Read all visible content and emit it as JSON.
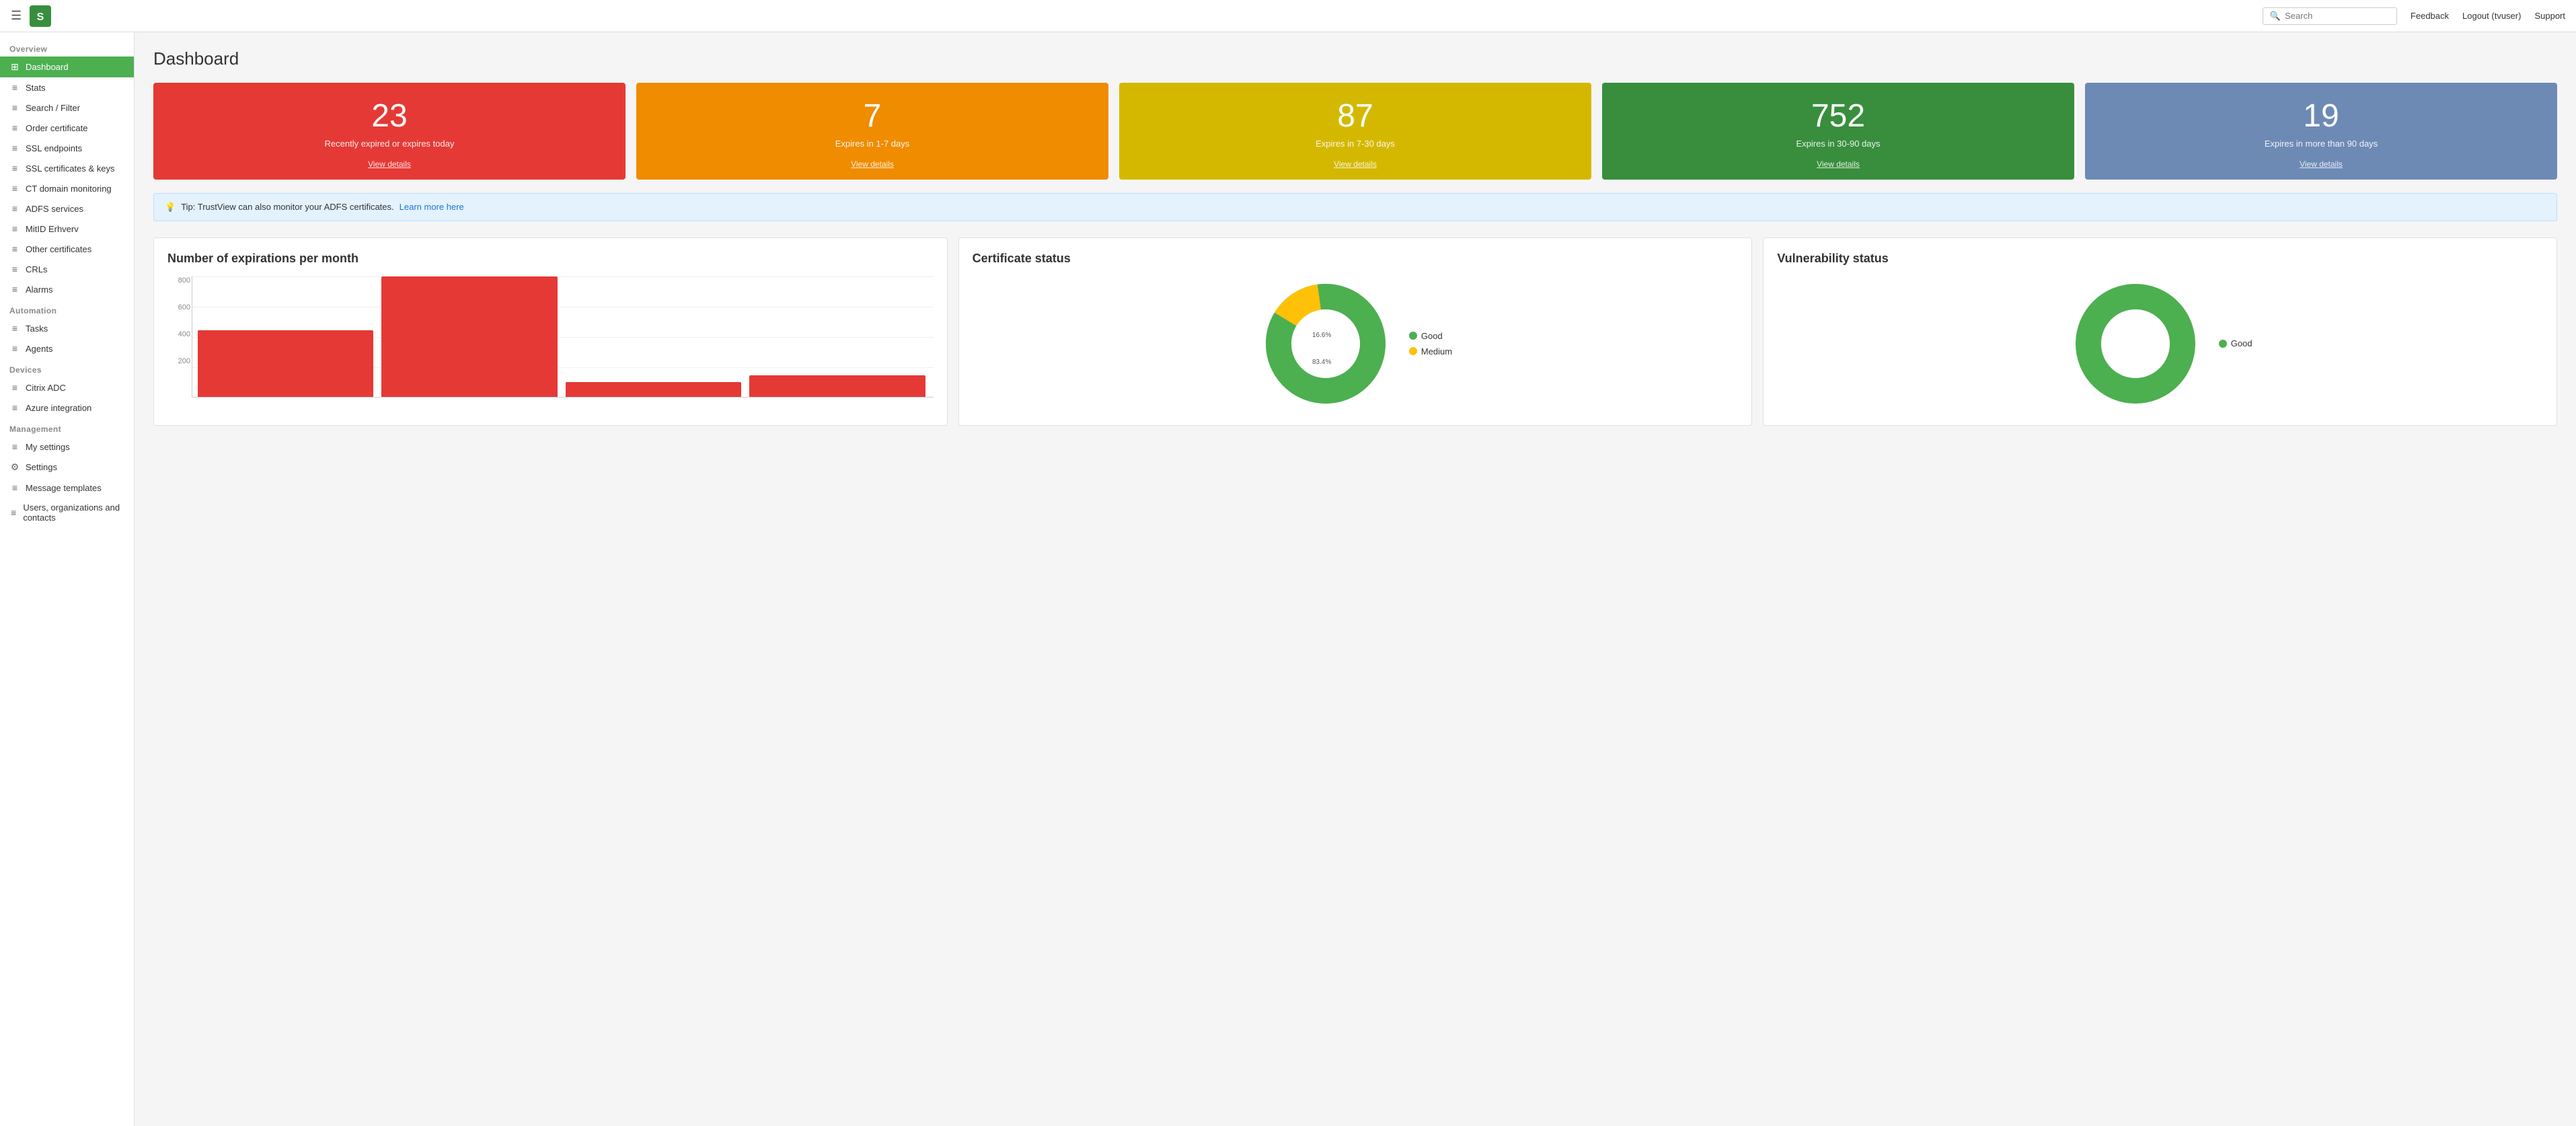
{
  "topbar": {
    "search_placeholder": "Search",
    "feedback_label": "Feedback",
    "logout_label": "Logout (tvuser)",
    "support_label": "Support"
  },
  "sidebar": {
    "overview_section": "Overview",
    "automation_section": "Automation",
    "devices_section": "Devices",
    "management_section": "Management",
    "items": [
      {
        "id": "dashboard",
        "label": "Dashboard",
        "active": true
      },
      {
        "id": "stats",
        "label": "Stats",
        "active": false
      },
      {
        "id": "search-filter",
        "label": "Search / Filter",
        "active": false
      },
      {
        "id": "order-certificate",
        "label": "Order certificate",
        "active": false
      },
      {
        "id": "ssl-endpoints",
        "label": "SSL endpoints",
        "active": false
      },
      {
        "id": "ssl-certificates-keys",
        "label": "SSL certificates & keys",
        "active": false
      },
      {
        "id": "ct-domain-monitoring",
        "label": "CT domain monitoring",
        "active": false
      },
      {
        "id": "adfs-services",
        "label": "ADFS services",
        "active": false
      },
      {
        "id": "mitid-erhverv",
        "label": "MitID Erhverv",
        "active": false
      },
      {
        "id": "other-certificates",
        "label": "Other certificates",
        "active": false
      },
      {
        "id": "crls",
        "label": "CRLs",
        "active": false
      },
      {
        "id": "alarms",
        "label": "Alarms",
        "active": false
      },
      {
        "id": "tasks",
        "label": "Tasks",
        "active": false
      },
      {
        "id": "agents",
        "label": "Agents",
        "active": false
      },
      {
        "id": "citrix-adc",
        "label": "Citrix ADC",
        "active": false
      },
      {
        "id": "azure-integration",
        "label": "Azure integration",
        "active": false
      },
      {
        "id": "my-settings",
        "label": "My settings",
        "active": false
      },
      {
        "id": "settings",
        "label": "Settings",
        "active": false
      },
      {
        "id": "message-templates",
        "label": "Message templates",
        "active": false
      },
      {
        "id": "users-organizations-contacts",
        "label": "Users, organizations and contacts",
        "active": false
      }
    ]
  },
  "dashboard": {
    "title": "Dashboard",
    "stat_cards": [
      {
        "number": "23",
        "desc": "Recently expired or expires today",
        "view_details": "View details",
        "color_class": "card-red"
      },
      {
        "number": "7",
        "desc": "Expires in 1-7 days",
        "view_details": "View details",
        "color_class": "card-orange"
      },
      {
        "number": "87",
        "desc": "Expires in 7-30 days",
        "view_details": "View details",
        "color_class": "card-yellow"
      },
      {
        "number": "752",
        "desc": "Expires in 30-90 days",
        "view_details": "View details",
        "color_class": "card-green"
      },
      {
        "number": "19",
        "desc": "Expires in more than 90 days",
        "view_details": "View details",
        "color_class": "card-blue"
      }
    ],
    "tip": {
      "text": "Tip: TrustView can also monitor your ADFS certificates.",
      "link_text": "Learn more here",
      "link_href": "#"
    },
    "charts": [
      {
        "id": "expirations-per-month",
        "title": "Number of expirations per month",
        "type": "bar",
        "y_labels": [
          "800",
          "600",
          "400",
          "200"
        ],
        "bars": [
          {
            "height_pct": 55,
            "label": ""
          },
          {
            "height_pct": 100,
            "label": ""
          },
          {
            "height_pct": 12,
            "label": ""
          },
          {
            "height_pct": 18,
            "label": ""
          }
        ]
      },
      {
        "id": "certificate-status",
        "title": "Certificate status",
        "type": "donut",
        "segments": [
          {
            "label": "Good",
            "value": 83.4,
            "color": "#4caf50"
          },
          {
            "label": "Medium",
            "value": 16.6,
            "color": "#ffc107"
          }
        ],
        "labels_on_chart": [
          "16.6%",
          "83.4%"
        ]
      },
      {
        "id": "vulnerability-status",
        "title": "Vulnerability status",
        "type": "donut",
        "segments": [
          {
            "label": "Good",
            "value": 100,
            "color": "#4caf50"
          }
        ]
      }
    ]
  }
}
